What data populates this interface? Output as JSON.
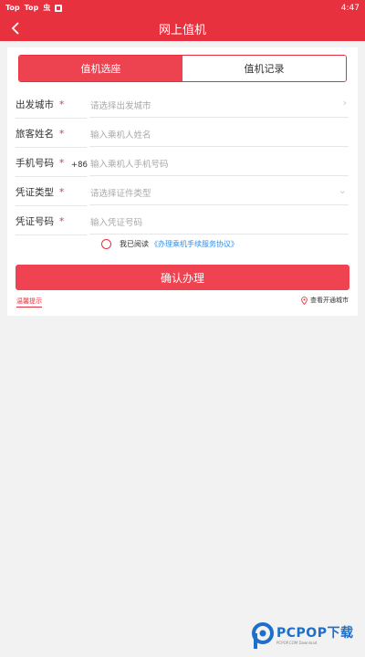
{
  "status_bar": {
    "items": [
      "Top",
      "Top",
      "虫"
    ],
    "time": "4:47"
  },
  "nav": {
    "title": "网上值机"
  },
  "tabs": [
    {
      "label": "值机选座",
      "active": true
    },
    {
      "label": "值机记录",
      "active": false
    }
  ],
  "form": {
    "departure_city": {
      "label": "出发城市",
      "required": "*",
      "placeholder": "请选择出发城市"
    },
    "passenger_name": {
      "label": "旅客姓名",
      "required": "*",
      "placeholder": "输入乘机人姓名"
    },
    "phone": {
      "label": "手机号码",
      "required": "*",
      "prefix": "+86",
      "placeholder": "输入乘机人手机号码"
    },
    "id_type": {
      "label": "凭证类型",
      "required": "*",
      "placeholder": "请选择证件类型"
    },
    "id_number": {
      "label": "凭证号码",
      "required": "*",
      "placeholder": "输入凭证号码"
    }
  },
  "agreement": {
    "text": "我已阅读",
    "link": "《办理乘机手续服务协议》",
    "checked": false
  },
  "confirm_button": "确认办理",
  "footer": {
    "tips": "温馨提示",
    "cities": "查看开通城市"
  },
  "watermark": {
    "brand": "PCPOP",
    "suffix": "下载",
    "sub": "PCPOP.COM Download"
  },
  "colors": {
    "primary": "#e8313f",
    "link": "#2f8ee9",
    "background": "#f2f2f2"
  }
}
